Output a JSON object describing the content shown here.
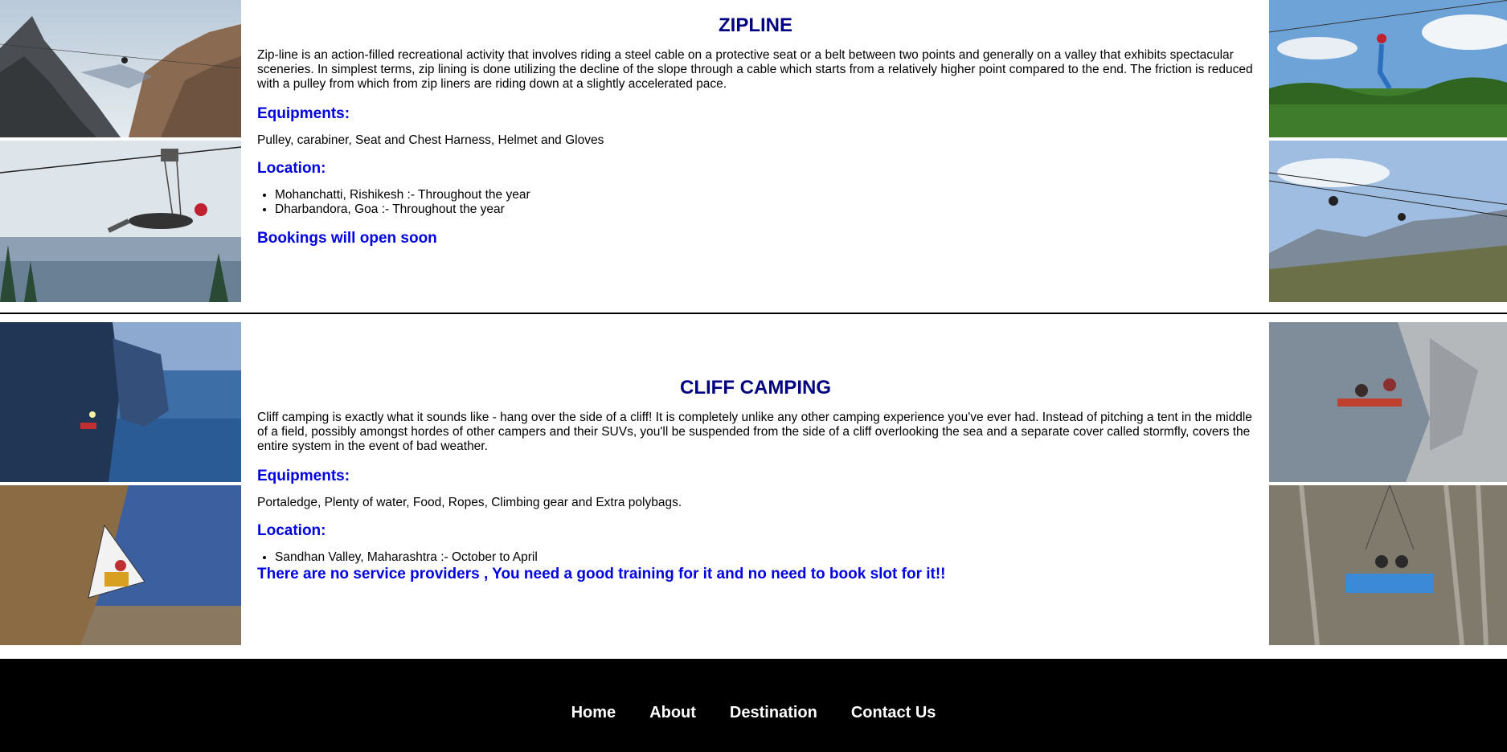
{
  "zipline": {
    "title": "ZIPLINE",
    "description": "Zip-line is an action-filled recreational activity that involves riding a steel cable on a protective seat or a belt between two points and generally on a valley that exhibits spectacular sceneries. In simplest terms, zip lining is done utilizing the decline of the slope through a cable which starts from a relatively higher point compared to the end. The friction is reduced with a pulley from which from zip liners are riding down at a slightly accelerated pace.",
    "equipments_heading": "Equipments:",
    "equipments": "Pulley, carabiner, Seat and Chest Harness, Helmet and Gloves",
    "location_heading": "Location:",
    "locations": [
      "Mohanchatti, Rishikesh :- Throughout the year",
      "Dharbandora, Goa :- Throughout the year"
    ],
    "note": "Bookings will open soon"
  },
  "cliff": {
    "title": "CLIFF CAMPING",
    "description": "Cliff camping is exactly what it sounds like - hang over the side of a cliff! It is completely unlike any other camping experience you've ever had. Instead of pitching a tent in the middle of a field, possibly amongst hordes of other campers and their SUVs, you'll be suspended from the side of a cliff overlooking the sea and a separate cover called stormfly, covers the entire system in the event of bad weather.",
    "equipments_heading": "Equipments:",
    "equipments": "Portaledge, Plenty of water, Food, Ropes, Climbing gear and Extra polybags.",
    "location_heading": "Location:",
    "locations": [
      "Sandhan Valley, Maharashtra :- October to April"
    ],
    "note": "There are no service providers , You need a good training for it and no need to book slot for it!!"
  },
  "nav": {
    "items": [
      "Home",
      "About",
      "Destination",
      "Contact Us"
    ]
  },
  "colors": {
    "title": "#000080",
    "heading": "#0000e0",
    "footer_bg": "#000000",
    "footer_text": "#ffffff"
  }
}
